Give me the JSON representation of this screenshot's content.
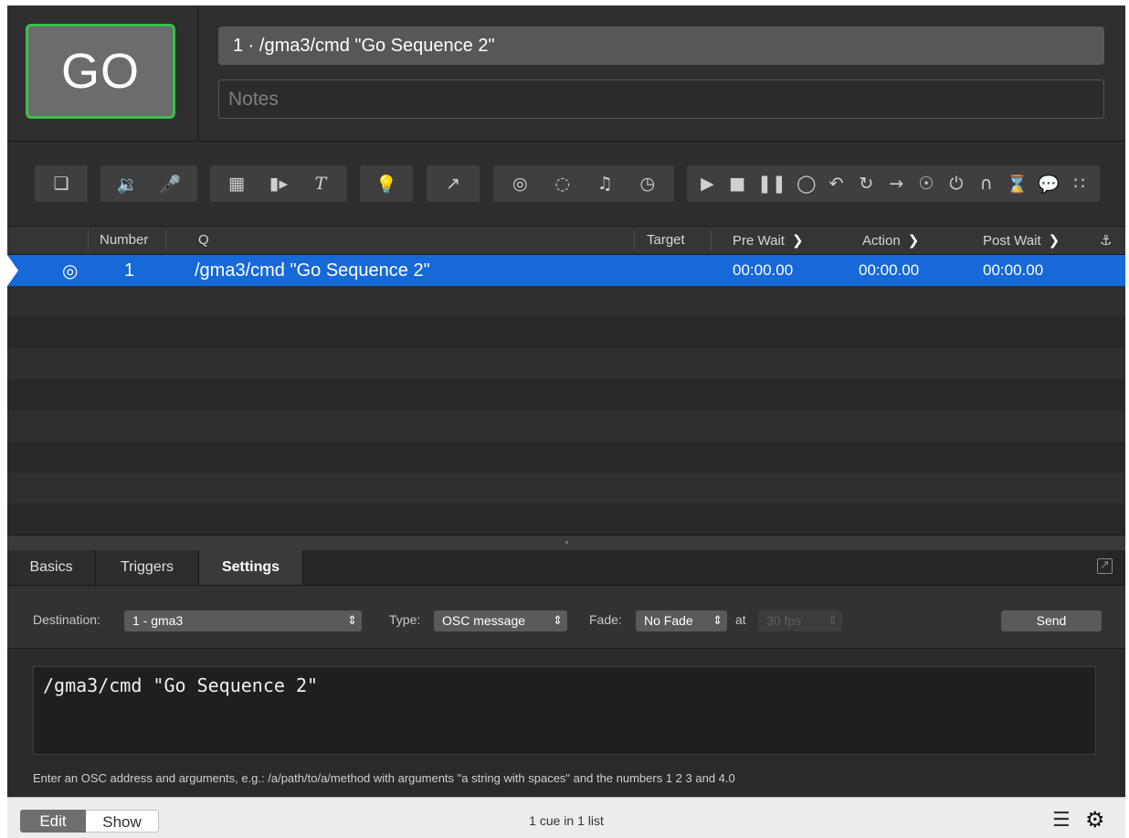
{
  "go_button": {
    "label": "GO"
  },
  "cue_title": "1 · /gma3/cmd \"Go Sequence 2\"",
  "notes_placeholder": "Notes",
  "toolbar": {
    "icons": [
      "group-cue-icon",
      "audio-cue-icon",
      "mic-cue-icon",
      "video-cue-icon",
      "camera-cue-icon",
      "text-cue-icon",
      "light-cue-icon",
      "fade-cue-icon",
      "network-cue-icon",
      "midi-cue-icon",
      "music-cue-icon",
      "timecode-cue-icon",
      "start-icon",
      "stop-icon",
      "pause-icon",
      "load-icon",
      "reset-icon",
      "devamp-icon",
      "goto-icon",
      "target-icon",
      "arm-icon",
      "disarm-icon",
      "wait-icon",
      "memo-icon",
      "script-icon"
    ]
  },
  "cue_list": {
    "columns": {
      "number": "Number",
      "q": "Q",
      "target": "Target",
      "pre_wait": "Pre Wait",
      "action": "Action",
      "post_wait": "Post Wait"
    },
    "rows": [
      {
        "number": "1",
        "q": "/gma3/cmd \"Go Sequence 2\"",
        "target": "",
        "pre_wait": "00:00.00",
        "action": "00:00.00",
        "post_wait": "00:00.00",
        "selected": true
      }
    ]
  },
  "inspector": {
    "tabs": [
      "Basics",
      "Triggers",
      "Settings"
    ],
    "active_tab": "Settings",
    "destination_label": "Destination:",
    "destination_value": "1 - gma3",
    "type_label": "Type:",
    "type_value": "OSC message",
    "fade_label": "Fade:",
    "fade_value": "No Fade",
    "at_label": "at",
    "fps_value": "30 fps",
    "send_label": "Send",
    "osc_message": "/gma3/cmd \"Go Sequence 2\"",
    "hint": "Enter an OSC address and arguments, e.g.: /a/path/to/a/method with arguments \"a string with spaces\" and the numbers 1 2 3 and 4.0"
  },
  "status_bar": {
    "edit_label": "Edit",
    "show_label": "Show",
    "cue_count": "1 cue in 1 list"
  },
  "colors": {
    "go_border": "#36c24a",
    "selection": "#1769d8",
    "background": "#2b2b2b"
  }
}
